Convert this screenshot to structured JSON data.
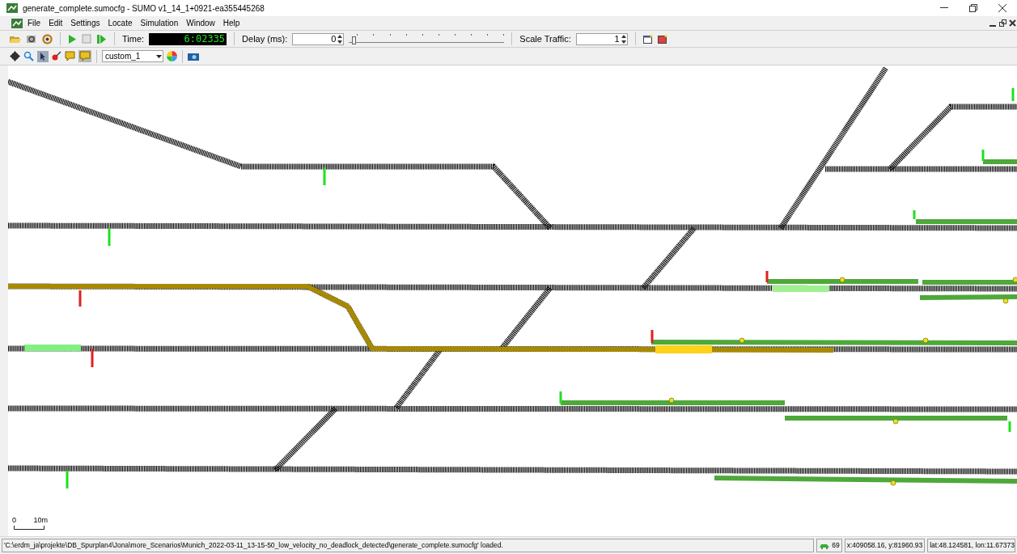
{
  "window": {
    "title": "generate_complete.sumocfg - SUMO v1_14_1+0921-ea355445268"
  },
  "menu": [
    "File",
    "Edit",
    "Settings",
    "Locate",
    "Simulation",
    "Window",
    "Help"
  ],
  "toolbar": {
    "time_label": "Time:",
    "time": "6:02335",
    "delay_label": "Delay (ms):",
    "delay": "0",
    "delay_slider": {
      "level": 0
    },
    "scale_label": "Scale Traffic:",
    "scale": "1"
  },
  "view_toolbar": {
    "scheme": "custom_1"
  },
  "scale_bar": {
    "start": "0",
    "end": "10m"
  },
  "status_bar": {
    "message": "'C:\\erdm_ja\\projekte\\DB_Spurplan4\\Jona\\more_Scenarios\\Munich_2022-03-11_13-15-50_low_velocity_no_deadlock_detected\\generate_complete.sumocfg' loaded.",
    "vehicles": "69",
    "coords": "x:409058.16, y:81960.93",
    "geo": "lat:48.124581, lon:11.67373"
  }
}
